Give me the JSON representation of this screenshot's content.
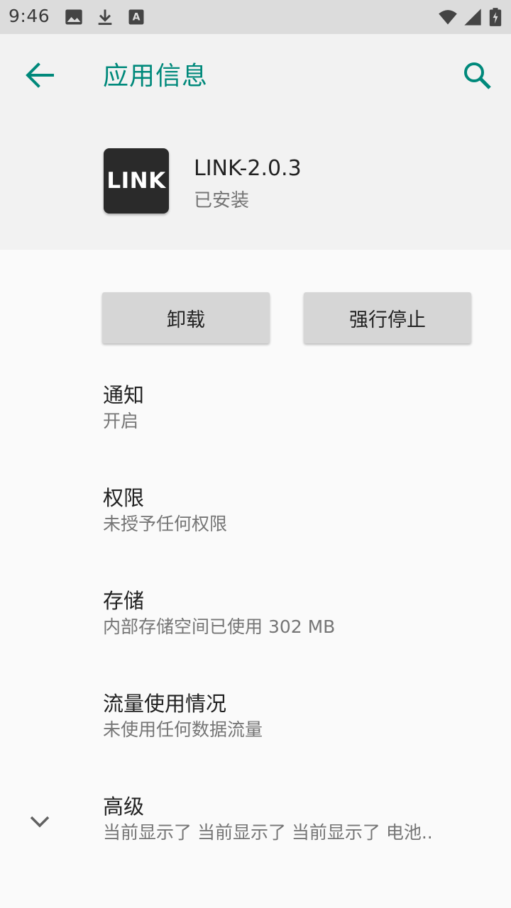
{
  "status_bar": {
    "time": "9:46",
    "icons": [
      "image-icon",
      "download-icon",
      "font-icon",
      "wifi-icon",
      "signal-icon",
      "battery-icon"
    ]
  },
  "toolbar": {
    "title": "应用信息",
    "back_icon": "arrow-left-icon",
    "search_icon": "search-icon",
    "accent_color": "#00897b"
  },
  "app": {
    "icon_text": "LINK",
    "name": "LINK-2.0.3",
    "status": "已安装"
  },
  "actions": {
    "uninstall_label": "卸载",
    "force_stop_label": "强行停止"
  },
  "settings": [
    {
      "title": "通知",
      "summary": "开启"
    },
    {
      "title": "权限",
      "summary": "未授予任何权限"
    },
    {
      "title": "存储",
      "summary": "内部存储空间已使用 302 MB"
    },
    {
      "title": "流量使用情况",
      "summary": "未使用任何数据流量"
    },
    {
      "title": "高级",
      "summary": "当前显示了 当前显示了 当前显示了 电池.."
    }
  ]
}
